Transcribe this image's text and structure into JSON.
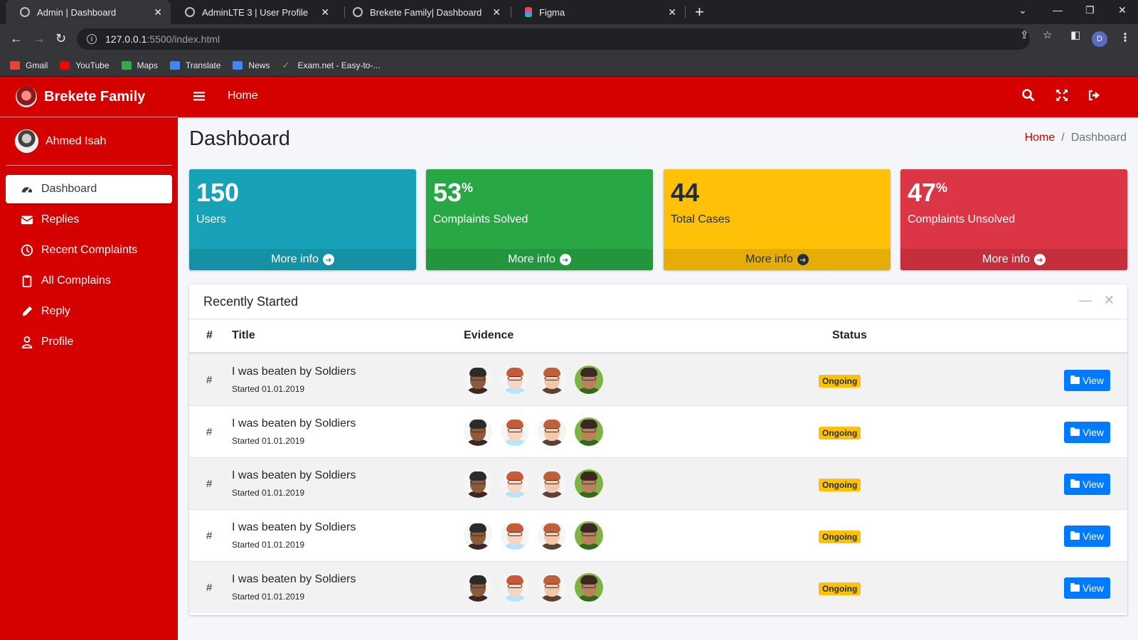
{
  "browser": {
    "tabs": [
      {
        "label": "Admin | Dashboard",
        "active": true
      },
      {
        "label": "AdminLTE 3 | User Profile",
        "active": false
      },
      {
        "label": "Brekete Family| Dashboard",
        "active": false
      },
      {
        "label": "Figma",
        "active": false
      }
    ],
    "url_host": "127.0.0.1",
    "url_path": ":5500/index.html",
    "profile_initial": "D",
    "bookmarks": [
      {
        "label": "Gmail",
        "color": "#ea4335"
      },
      {
        "label": "YouTube",
        "color": "#ff0000"
      },
      {
        "label": "Maps",
        "color": "#34a853"
      },
      {
        "label": "Translate",
        "color": "#4285f4"
      },
      {
        "label": "News",
        "color": "#4285f4"
      },
      {
        "label": "Exam.net - Easy-to-...",
        "color": "#7cb342"
      }
    ]
  },
  "sidebar": {
    "brand": "Brekete Family",
    "user_name": "Ahmed Isah",
    "items": [
      {
        "label": "Dashboard",
        "icon": "dashboard-icon",
        "active": true
      },
      {
        "label": "Replies",
        "icon": "envelope-icon",
        "active": false
      },
      {
        "label": "Recent Complaints",
        "icon": "clock-icon",
        "active": false
      },
      {
        "label": "All Complains",
        "icon": "clipboard-icon",
        "active": false
      },
      {
        "label": "Reply",
        "icon": "pencil-icon",
        "active": false
      },
      {
        "label": "Profile",
        "icon": "user-icon",
        "active": false
      }
    ]
  },
  "topnav": {
    "home": "Home"
  },
  "page": {
    "title": "Dashboard",
    "breadcrumb_home": "Home",
    "breadcrumb_current": "Dashboard"
  },
  "stats": [
    {
      "value": "150",
      "suffix": "",
      "label": "Users",
      "footer": "More info",
      "color": "#17a2b8"
    },
    {
      "value": "53",
      "suffix": "%",
      "label": "Complaints Solved",
      "footer": "More info",
      "color": "#28a745"
    },
    {
      "value": "44",
      "suffix": "",
      "label": "Total Cases",
      "footer": "More info",
      "color": "#ffc107"
    },
    {
      "value": "47",
      "suffix": "%",
      "label": "Complaints Unsolved",
      "footer": "More info",
      "color": "#dc3545"
    }
  ],
  "recent": {
    "title": "Recently Started",
    "columns": {
      "hash": "#",
      "title": "Title",
      "evidence": "Evidence",
      "status": "Status"
    },
    "rows": [
      {
        "hash": "#",
        "title": "I was beaten by Soldiers",
        "sub": "Started 01.01.2019",
        "status": "Ongoing",
        "action": "View"
      },
      {
        "hash": "#",
        "title": "I was beaten by Soldiers",
        "sub": "Started 01.01.2019",
        "status": "Ongoing",
        "action": "View"
      },
      {
        "hash": "#",
        "title": "I was beaten by Soldiers",
        "sub": "Started 01.01.2019",
        "status": "Ongoing",
        "action": "View"
      },
      {
        "hash": "#",
        "title": "I was beaten by Soldiers",
        "sub": "Started 01.01.2019",
        "status": "Ongoing",
        "action": "View"
      },
      {
        "hash": "#",
        "title": "I was beaten by Soldiers",
        "sub": "Started 01.01.2019",
        "status": "Ongoing",
        "action": "View"
      }
    ]
  },
  "colors": {
    "brand_red": "#d50000",
    "primary": "#007bff",
    "badge": "#ffc107"
  }
}
